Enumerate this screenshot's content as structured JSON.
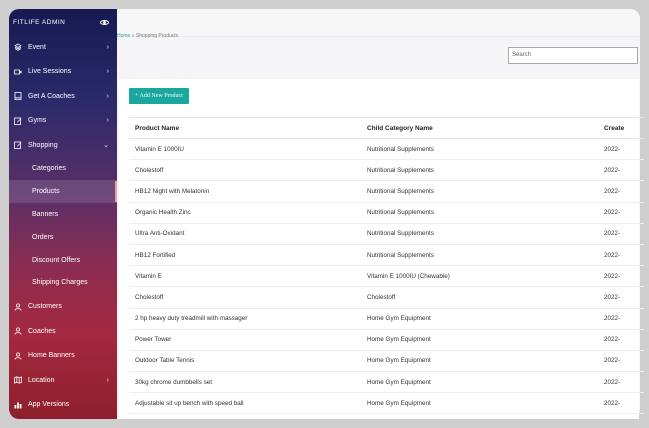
{
  "brand": {
    "title": "FITLIFE ADMIN"
  },
  "sidebar": {
    "items": [
      {
        "label": "Event",
        "icon": "layers-icon"
      },
      {
        "label": "Live Sessions",
        "icon": "video-icon"
      },
      {
        "label": "Get A Coaches",
        "icon": "tablet-icon"
      },
      {
        "label": "Gyms",
        "icon": "edit-icon"
      },
      {
        "label": "Shopping",
        "icon": "edit-icon"
      }
    ],
    "shopping_sub": [
      "Categories",
      "Products",
      "Banners",
      "Orders",
      "Discount Offers",
      "Shipping Charges"
    ],
    "bottom_items": [
      {
        "label": "Customers",
        "icon": "user-icon"
      },
      {
        "label": "Coaches",
        "icon": "user-icon"
      },
      {
        "label": "Home Banners",
        "icon": "user-icon"
      },
      {
        "label": "Location",
        "icon": "map-icon"
      },
      {
        "label": "App Versions",
        "icon": "bar-chart-icon"
      }
    ]
  },
  "breadcrumb": {
    "home": "Home",
    "separator": "»",
    "current": "Shopping Products"
  },
  "search": {
    "placeholder": "Search"
  },
  "actions": {
    "add_label": "+ Add New Product"
  },
  "table": {
    "headers": [
      "Product Name",
      "Child Category Name",
      "Create"
    ],
    "rows": [
      [
        "Vitamin E 1000IU",
        "Nutritional Supplements",
        "2022-"
      ],
      [
        "Cholestoff",
        "Nutritional Supplements",
        "2022-"
      ],
      [
        "HB12 Night with Melatonin",
        "Nutritional Supplements",
        "2022-"
      ],
      [
        "Organic Health Zinc",
        "Nutritional Supplements",
        "2022-"
      ],
      [
        "Ultra Anti-Oxidant",
        "Nutritional Supplements",
        "2022-"
      ],
      [
        "HB12 Fortified",
        "Nutritional Supplements",
        "2022-"
      ],
      [
        "Vitamin E",
        "Vitamin E 1000IU (Chewable)",
        "2022-"
      ],
      [
        "Cholestoff",
        "Cholestoff",
        "2022-"
      ],
      [
        "2 hp heavy duty treadmill with massager",
        "Home Gym Equipment",
        "2022-"
      ],
      [
        "Power Tower",
        "Home Gym Equipment",
        "2022-"
      ],
      [
        "Outdoor Table Tennis",
        "Home Gym Equipment",
        "2022-"
      ],
      [
        "30kg chrome dumbbells set",
        "Home Gym Equipment",
        "2022-"
      ],
      [
        "Adjustable sit up bench with speed ball",
        "Home Gym Equipment",
        "2022-"
      ]
    ]
  }
}
